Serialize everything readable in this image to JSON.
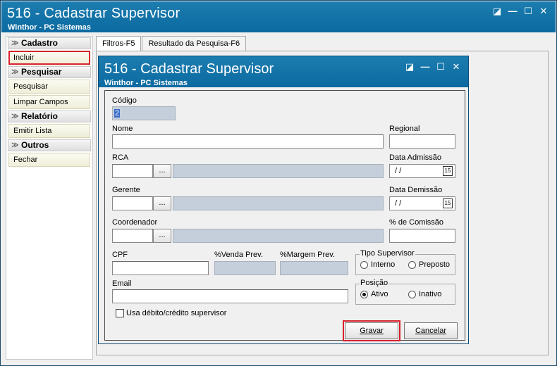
{
  "window": {
    "title": "516 - Cadastrar Supervisor",
    "subtitle": "Winthor - PC Sistemas"
  },
  "window_controls": [
    "◪",
    "—",
    "☐",
    "✕"
  ],
  "sidebar": {
    "groups": [
      {
        "title": "Cadastro",
        "items": [
          "Incluir"
        ]
      },
      {
        "title": "Pesquisar",
        "items": [
          "Pesquisar",
          "Limpar Campos"
        ]
      },
      {
        "title": "Relatório",
        "items": [
          "Emitir Lista"
        ]
      },
      {
        "title": "Outros",
        "items": [
          "Fechar"
        ]
      }
    ]
  },
  "tabs": [
    "Filtros-F5",
    "Resultado da Pesquisa-F6"
  ],
  "dialog": {
    "title": "516 - Cadastrar Supervisor",
    "subtitle": "Winthor - PC Sistemas",
    "form": {
      "codigo_label": "Código",
      "codigo_value": "2",
      "nome_label": "Nome",
      "regional_label": "Regional",
      "rca_label": "RCA",
      "data_admissao_label": "Data Admissão",
      "data_admissao_value": "/ /",
      "gerente_label": "Gerente",
      "data_demissao_label": "Data Demissão",
      "data_demissao_value": "/ /",
      "coordenador_label": "Coordenador",
      "comissao_label": "% de Comissão",
      "cpf_label": "CPF",
      "venda_prev_label": "%Venda Prev.",
      "margem_prev_label": "%Margem Prev.",
      "tipo_supervisor_label": "Tipo Supervisor",
      "tipo_options": [
        "Interno",
        "Preposto"
      ],
      "email_label": "Email",
      "posicao_label": "Posição",
      "posicao_options": [
        "Ativo",
        "Inativo"
      ],
      "debito_credito_label": "Usa débito/crédito supervisor",
      "dots_label": "...",
      "calendar_label": "15"
    },
    "buttons": {
      "gravar": "Gravar",
      "cancelar": "Cancelar"
    }
  }
}
